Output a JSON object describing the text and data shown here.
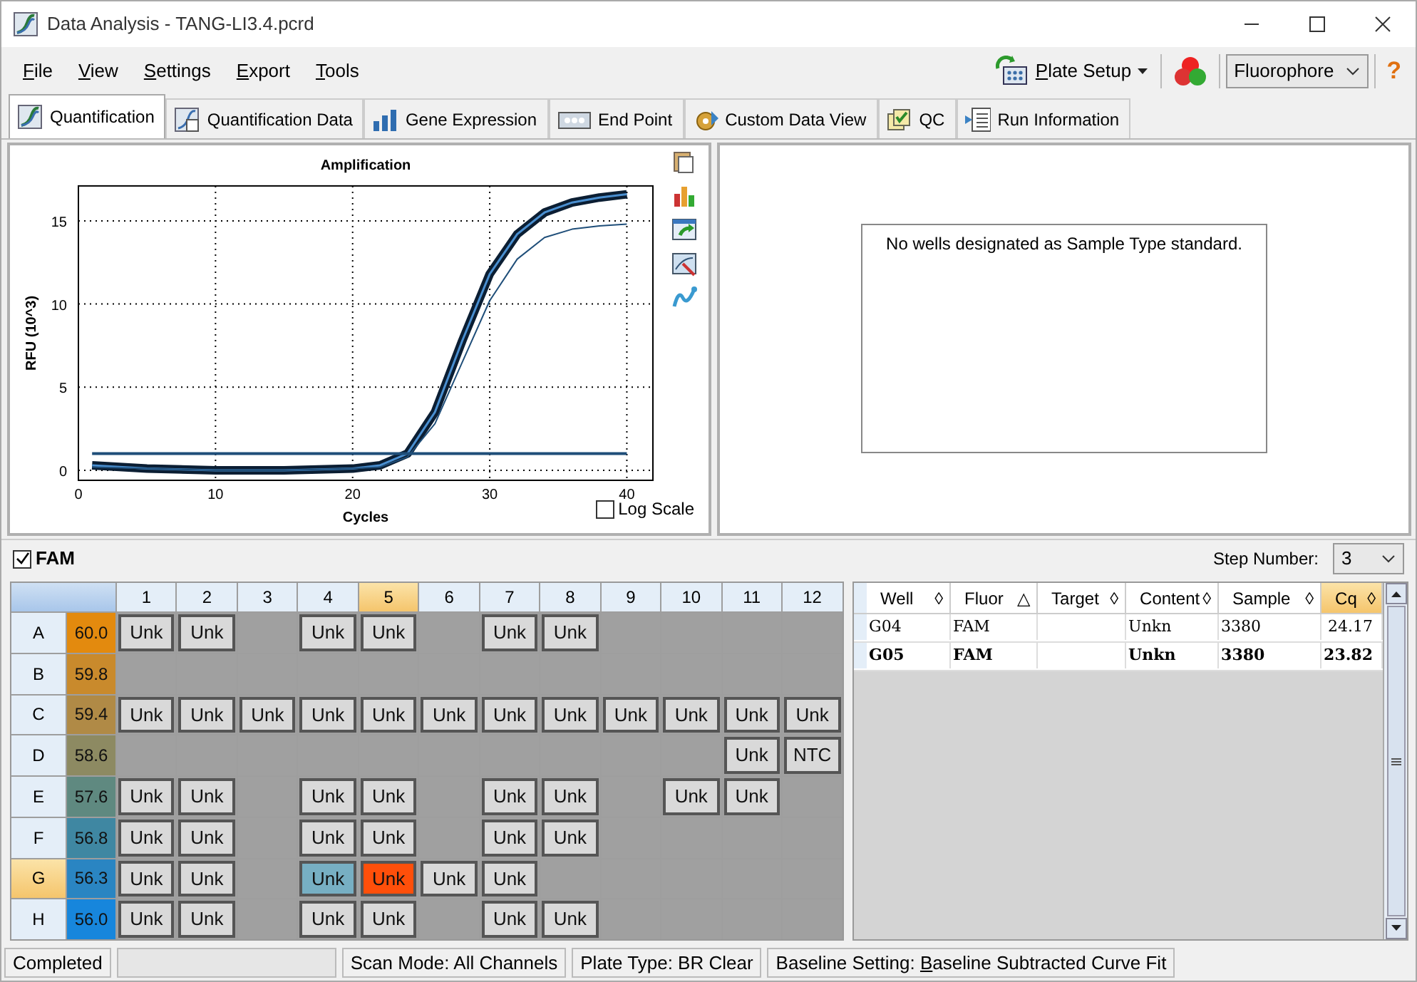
{
  "window": {
    "title": "Data Analysis - TANG-LI3.4.pcrd"
  },
  "menu": [
    {
      "accel": "F",
      "after": "ile"
    },
    {
      "accel": "V",
      "after": "iew"
    },
    {
      "accel": "S",
      "after": "ettings"
    },
    {
      "accel": "E",
      "after": "xport"
    },
    {
      "accel": "T",
      "after": "ools"
    }
  ],
  "toolbar": {
    "plate_setup": {
      "accel": "P",
      "after": "late Setup"
    },
    "fluorophore": "Fluorophore",
    "help": "?"
  },
  "tabs": [
    {
      "label": "Quantification",
      "selected": true
    },
    {
      "label": "Quantification Data",
      "selected": false
    },
    {
      "label": "Gene Expression",
      "selected": false
    },
    {
      "label": "End Point",
      "selected": false
    },
    {
      "label": "Custom Data View",
      "selected": false
    },
    {
      "label": "QC",
      "selected": false
    },
    {
      "label": "Run Information",
      "selected": false
    }
  ],
  "amplification": {
    "log_scale": {
      "label": "Log Scale",
      "checked": false
    },
    "chart_data": {
      "type": "line",
      "grid": true,
      "title": "Amplification",
      "xlabel": "Cycles",
      "ylabel": "RFU (10^3)",
      "xlim": [
        0,
        41.9
      ],
      "ylim": [
        -0.6,
        17.1
      ],
      "xticks": [
        0,
        10,
        20,
        30,
        40
      ],
      "yticks": [
        0,
        5,
        10,
        15
      ],
      "x": [
        1,
        5,
        10,
        15,
        20,
        22,
        24,
        26,
        28,
        30,
        32,
        34,
        36,
        38,
        40
      ],
      "series": [
        {
          "color": "#0b1e33",
          "values": [
            0.3,
            0.1,
            0.0,
            0.0,
            0.1,
            0.3,
            1.0,
            3.5,
            7.8,
            11.8,
            14.2,
            15.5,
            16.1,
            16.4,
            16.6
          ]
        },
        {
          "color": "#1f4e79",
          "values": [
            0.2,
            0.1,
            0.0,
            0.0,
            0.1,
            0.2,
            0.8,
            2.8,
            6.5,
            10.2,
            12.7,
            14.0,
            14.5,
            14.7,
            14.8
          ]
        },
        {
          "color": "#1f4e79",
          "values": [
            1.0,
            1.0,
            1.0,
            1.0,
            1.0,
            1.0,
            1.0,
            1.0,
            1.0,
            1.0,
            1.0,
            1.0,
            1.0,
            1.0,
            1.0
          ]
        }
      ]
    }
  },
  "standard_curve": {
    "message": "No wells designated as Sample Type standard."
  },
  "fluor_bar": {
    "label": "FAM",
    "checked": true,
    "step_label": "Step Number:",
    "step": "3"
  },
  "plate": {
    "columns": [
      {
        "label": "1",
        "highlighted": false
      },
      {
        "label": "2",
        "highlighted": false
      },
      {
        "label": "3",
        "highlighted": false
      },
      {
        "label": "4",
        "highlighted": false
      },
      {
        "label": "5",
        "highlighted": true
      },
      {
        "label": "6",
        "highlighted": false
      },
      {
        "label": "7",
        "highlighted": false
      },
      {
        "label": "8",
        "highlighted": false
      },
      {
        "label": "9",
        "highlighted": false
      },
      {
        "label": "10",
        "highlighted": false
      },
      {
        "label": "11",
        "highlighted": false
      },
      {
        "label": "12",
        "highlighted": false
      }
    ],
    "rows": [
      {
        "label": "A",
        "highlighted": false,
        "temperature": "60.0",
        "color": "#e38a0e",
        "wells": [
          {
            "kind": "sample",
            "label": "Unk",
            "selected": false
          },
          {
            "kind": "sample",
            "label": "Unk",
            "selected": false
          },
          {
            "kind": "empty"
          },
          {
            "kind": "sample",
            "label": "Unk",
            "selected": false
          },
          {
            "kind": "sample",
            "label": "Unk",
            "selected": false
          },
          {
            "kind": "empty"
          },
          {
            "kind": "sample",
            "label": "Unk",
            "selected": false
          },
          {
            "kind": "sample",
            "label": "Unk",
            "selected": false
          },
          {
            "kind": "empty"
          },
          {
            "kind": "empty"
          },
          {
            "kind": "empty"
          },
          {
            "kind": "empty"
          }
        ]
      },
      {
        "label": "B",
        "highlighted": false,
        "temperature": "59.8",
        "color": "#c98a2c",
        "wells": [
          {
            "kind": "empty"
          },
          {
            "kind": "empty"
          },
          {
            "kind": "empty"
          },
          {
            "kind": "empty"
          },
          {
            "kind": "empty"
          },
          {
            "kind": "empty"
          },
          {
            "kind": "empty"
          },
          {
            "kind": "empty"
          },
          {
            "kind": "empty"
          },
          {
            "kind": "empty"
          },
          {
            "kind": "empty"
          },
          {
            "kind": "empty"
          }
        ]
      },
      {
        "label": "C",
        "highlighted": false,
        "temperature": "59.4",
        "color": "#b08a46",
        "wells": [
          {
            "kind": "sample",
            "label": "Unk",
            "selected": false
          },
          {
            "kind": "sample",
            "label": "Unk",
            "selected": false
          },
          {
            "kind": "sample",
            "label": "Unk",
            "selected": false
          },
          {
            "kind": "sample",
            "label": "Unk",
            "selected": false
          },
          {
            "kind": "sample",
            "label": "Unk",
            "selected": false
          },
          {
            "kind": "sample",
            "label": "Unk",
            "selected": false
          },
          {
            "kind": "sample",
            "label": "Unk",
            "selected": false
          },
          {
            "kind": "sample",
            "label": "Unk",
            "selected": false
          },
          {
            "kind": "sample",
            "label": "Unk",
            "selected": false
          },
          {
            "kind": "sample",
            "label": "Unk",
            "selected": false
          },
          {
            "kind": "sample",
            "label": "Unk",
            "selected": false
          },
          {
            "kind": "sample",
            "label": "Unk",
            "selected": false
          }
        ]
      },
      {
        "label": "D",
        "highlighted": false,
        "temperature": "58.6",
        "color": "#8d8a62",
        "wells": [
          {
            "kind": "empty"
          },
          {
            "kind": "empty"
          },
          {
            "kind": "empty"
          },
          {
            "kind": "empty"
          },
          {
            "kind": "empty"
          },
          {
            "kind": "empty"
          },
          {
            "kind": "empty"
          },
          {
            "kind": "empty"
          },
          {
            "kind": "empty"
          },
          {
            "kind": "empty"
          },
          {
            "kind": "sample",
            "label": "Unk",
            "selected": false
          },
          {
            "kind": "sample",
            "label": "NTC",
            "selected": false
          }
        ]
      },
      {
        "label": "E",
        "highlighted": false,
        "temperature": "57.6",
        "color": "#5f8980",
        "wells": [
          {
            "kind": "sample",
            "label": "Unk",
            "selected": false
          },
          {
            "kind": "sample",
            "label": "Unk",
            "selected": false
          },
          {
            "kind": "empty"
          },
          {
            "kind": "sample",
            "label": "Unk",
            "selected": false
          },
          {
            "kind": "sample",
            "label": "Unk",
            "selected": false
          },
          {
            "kind": "empty"
          },
          {
            "kind": "sample",
            "label": "Unk",
            "selected": false
          },
          {
            "kind": "sample",
            "label": "Unk",
            "selected": false
          },
          {
            "kind": "empty"
          },
          {
            "kind": "sample",
            "label": "Unk",
            "selected": false
          },
          {
            "kind": "sample",
            "label": "Unk",
            "selected": false
          },
          {
            "kind": "empty"
          }
        ]
      },
      {
        "label": "F",
        "highlighted": false,
        "temperature": "56.8",
        "color": "#3f87a2",
        "wells": [
          {
            "kind": "sample",
            "label": "Unk",
            "selected": false
          },
          {
            "kind": "sample",
            "label": "Unk",
            "selected": false
          },
          {
            "kind": "empty"
          },
          {
            "kind": "sample",
            "label": "Unk",
            "selected": false
          },
          {
            "kind": "sample",
            "label": "Unk",
            "selected": false
          },
          {
            "kind": "empty"
          },
          {
            "kind": "sample",
            "label": "Unk",
            "selected": false
          },
          {
            "kind": "sample",
            "label": "Unk",
            "selected": false
          },
          {
            "kind": "empty"
          },
          {
            "kind": "empty"
          },
          {
            "kind": "empty"
          },
          {
            "kind": "empty"
          }
        ]
      },
      {
        "label": "G",
        "highlighted": true,
        "temperature": "56.3",
        "color": "#2a85c2",
        "wells": [
          {
            "kind": "sample",
            "label": "Unk",
            "selected": false
          },
          {
            "kind": "sample",
            "label": "Unk",
            "selected": false
          },
          {
            "kind": "empty"
          },
          {
            "kind": "sample",
            "label": "Unk",
            "selected": true
          },
          {
            "kind": "sample",
            "label": "Unk",
            "selected": true,
            "current": true
          },
          {
            "kind": "sample",
            "label": "Unk",
            "selected": false
          },
          {
            "kind": "sample",
            "label": "Unk",
            "selected": false
          },
          {
            "kind": "empty"
          },
          {
            "kind": "empty"
          },
          {
            "kind": "empty"
          },
          {
            "kind": "empty"
          },
          {
            "kind": "empty"
          }
        ]
      },
      {
        "label": "H",
        "highlighted": false,
        "temperature": "56.0",
        "color": "#1786dc",
        "wells": [
          {
            "kind": "sample",
            "label": "Unk",
            "selected": false
          },
          {
            "kind": "sample",
            "label": "Unk",
            "selected": false
          },
          {
            "kind": "empty"
          },
          {
            "kind": "sample",
            "label": "Unk",
            "selected": false
          },
          {
            "kind": "sample",
            "label": "Unk",
            "selected": false
          },
          {
            "kind": "empty"
          },
          {
            "kind": "sample",
            "label": "Unk",
            "selected": false
          },
          {
            "kind": "sample",
            "label": "Unk",
            "selected": false
          },
          {
            "kind": "empty"
          },
          {
            "kind": "empty"
          },
          {
            "kind": "empty"
          },
          {
            "kind": "empty"
          }
        ]
      }
    ]
  },
  "table": {
    "columns": [
      {
        "label": "Well",
        "sort_mark": "◊",
        "highlighted": false
      },
      {
        "label": "Fluor",
        "sort_mark": "△",
        "highlighted": false
      },
      {
        "label": "Target",
        "sort_mark": "◊",
        "highlighted": false
      },
      {
        "label": "Content",
        "sort_mark": "◊",
        "highlighted": false
      },
      {
        "label": "Sample",
        "sort_mark": "◊",
        "highlighted": false
      },
      {
        "label": "Cq",
        "sort_mark": "◊",
        "highlighted": true
      }
    ],
    "rows": [
      {
        "current": false,
        "well": "G04",
        "fluor": "FAM",
        "content": "Unkn",
        "sample": "3380",
        "cq": "24.17"
      },
      {
        "current": true,
        "well": "G05",
        "fluor": "FAM",
        "content": "Unkn",
        "sample": "3380",
        "cq": "23.82"
      }
    ]
  },
  "status_bar": [
    {
      "kind": "text",
      "text": "Completed"
    },
    {
      "kind": "progress",
      "level": 0
    },
    {
      "kind": "text",
      "text": "Scan Mode: All Channels"
    },
    {
      "kind": "text",
      "text": "Plate Type: BR Clear"
    },
    {
      "kind": "accel",
      "before": "Baseline Setting: ",
      "accel": "B",
      "after": "aseline Subtracted Curve Fit"
    }
  ]
}
